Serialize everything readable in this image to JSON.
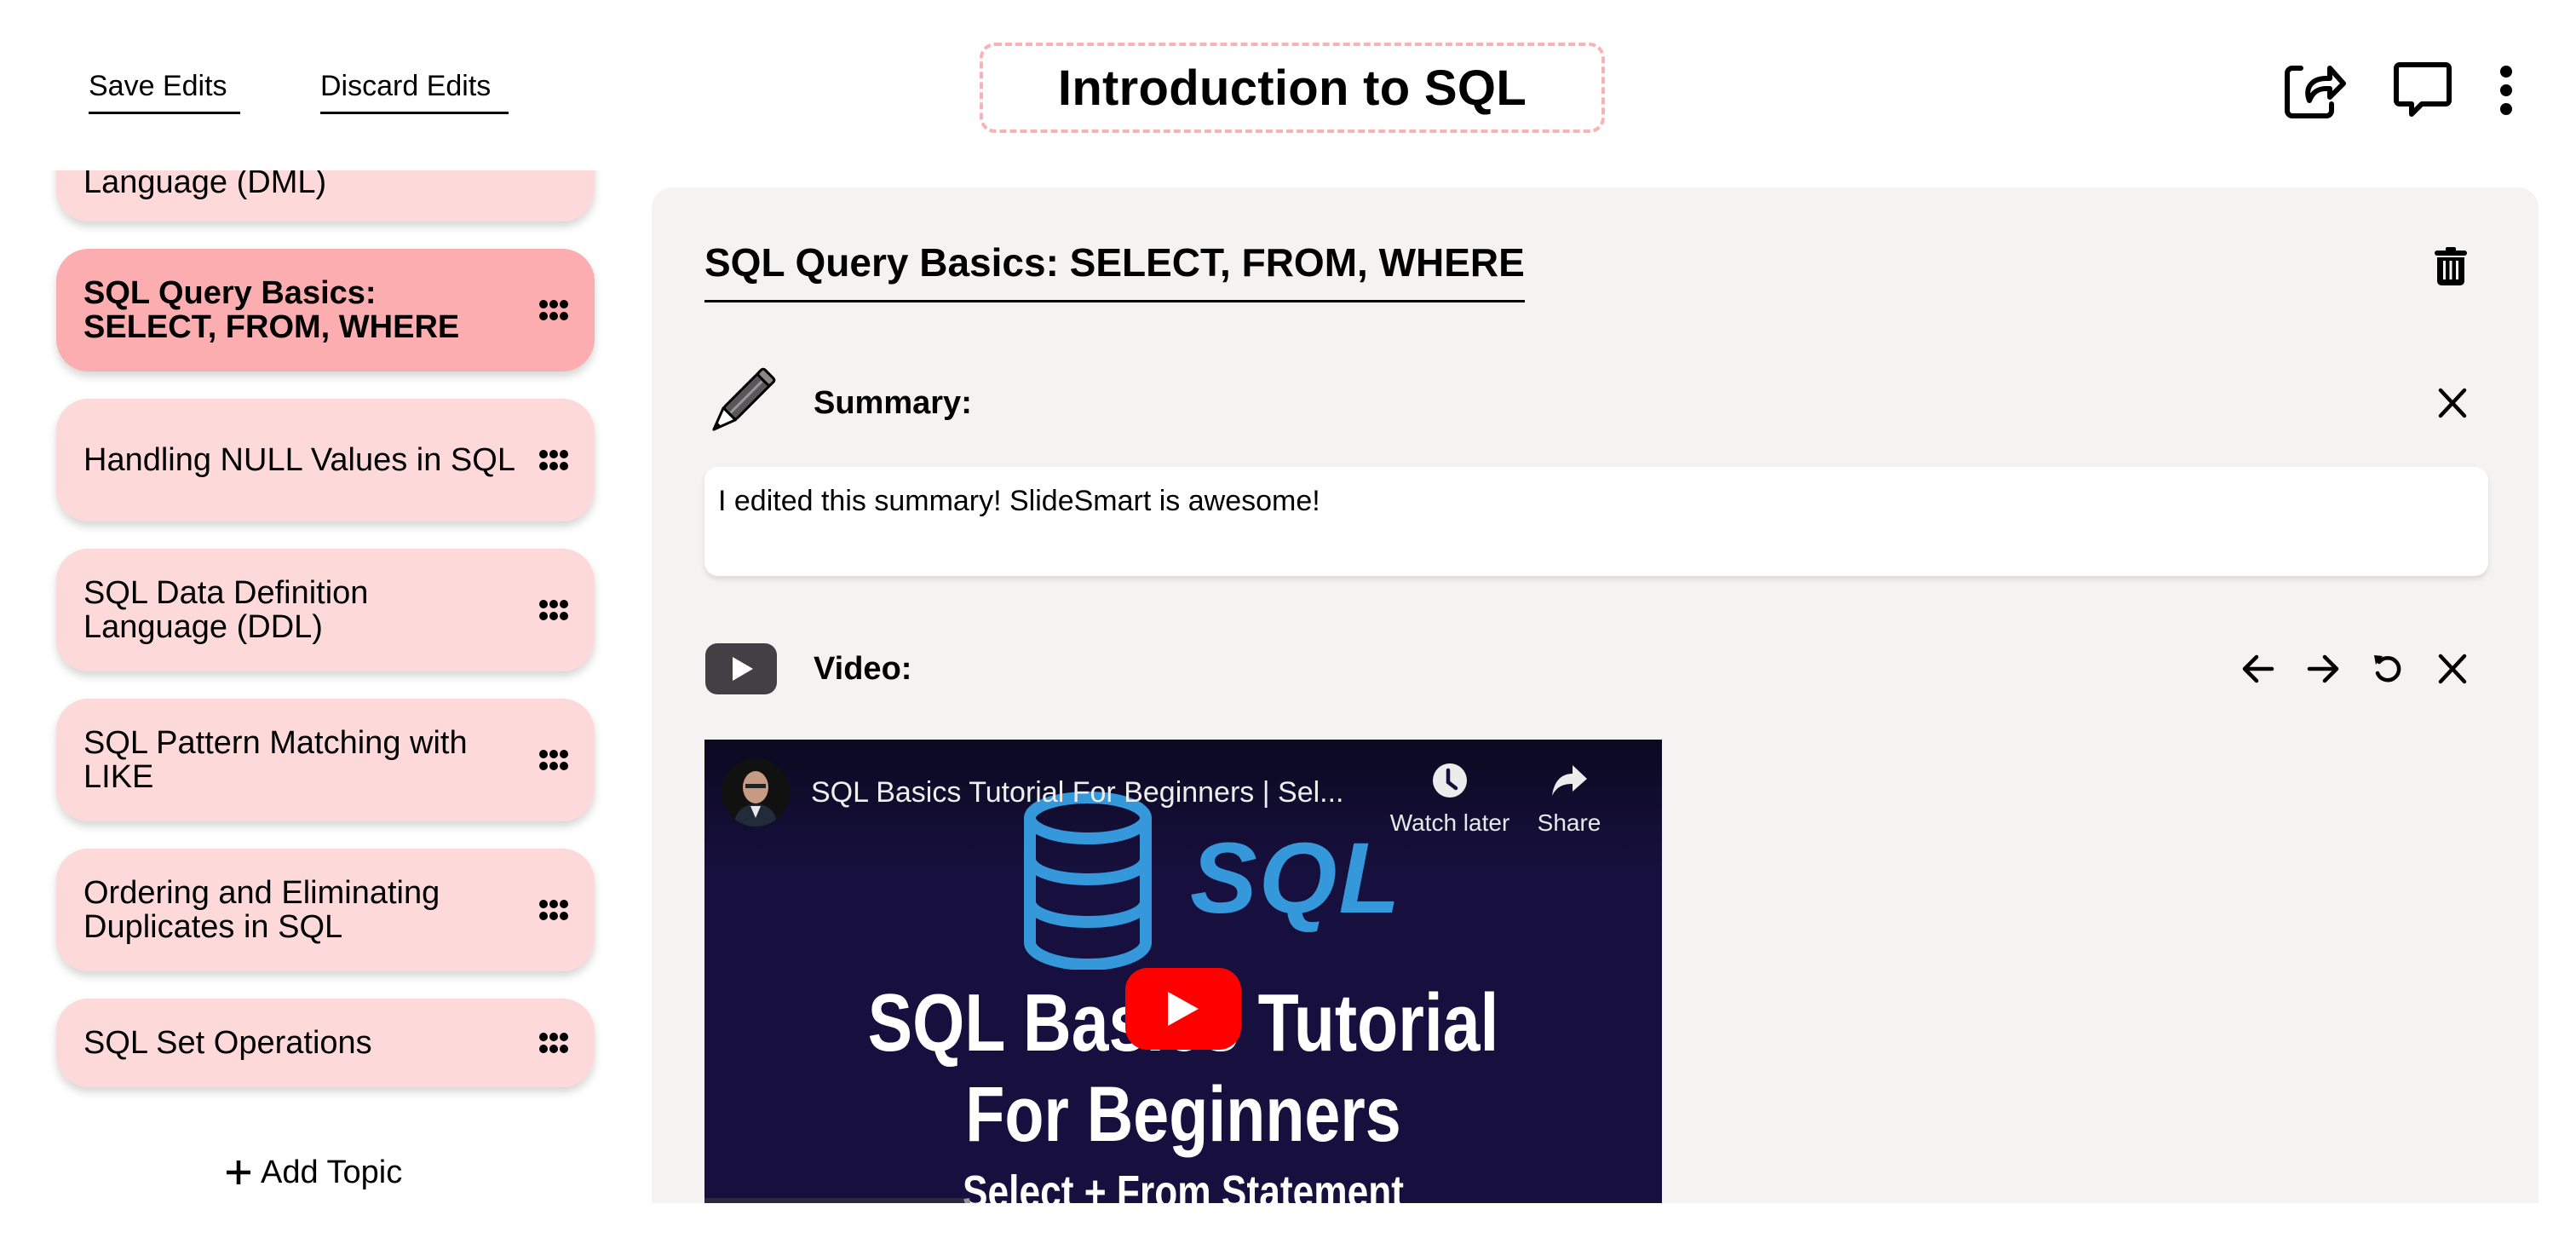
{
  "toolbar": {
    "save_label": "Save Edits",
    "discard_label": "Discard Edits",
    "presentation_title": "Introduction to SQL",
    "icons": [
      "share-icon",
      "comment-icon",
      "more-vertical-icon"
    ]
  },
  "sidebar": {
    "topics": [
      {
        "label": "SQL Data Manipulation Language (DML)",
        "visible_label": "Language (DML)",
        "active": false
      },
      {
        "label": "SQL Query Basics: SELECT, FROM, WHERE",
        "active": true
      },
      {
        "label": "Handling NULL Values in SQL",
        "active": false
      },
      {
        "label": "SQL Data Definition Language (DDL)",
        "active": false
      },
      {
        "label": "SQL Pattern Matching with LIKE",
        "active": false
      },
      {
        "label": "Ordering and Eliminating Duplicates in SQL",
        "active": false
      },
      {
        "label": "SQL Set Operations",
        "active": false
      }
    ],
    "add_topic_label": "Add Topic",
    "add_topic_icon": "plus-icon",
    "drag_icon": "drag-handle-icon"
  },
  "main": {
    "topic_title": "SQL Query Basics: SELECT, FROM, WHERE",
    "summary": {
      "label": "Summary:",
      "icon": "pencil-icon",
      "text": "I edited this summary! SlideSmart is awesome!"
    },
    "video": {
      "label": "Video:",
      "icon": "youtube-icon",
      "actions": [
        "arrow-left-icon",
        "arrow-right-icon",
        "refresh-icon",
        "close-icon"
      ],
      "player": {
        "title": "SQL Basics Tutorial For Beginners | Sel...",
        "watch_later_label": "Watch later",
        "share_label": "Share",
        "thumbnail_logo_text": "SQL",
        "thumbnail_line1": "SQL Basics Tutorial",
        "thumbnail_line2": "For Beginners",
        "thumbnail_line3": "Select + From Statement"
      }
    }
  },
  "colors": {
    "topic_bg": "#fdd9da",
    "topic_active_bg": "#fbadaf",
    "title_border": "#fbb2b4",
    "panel_bg": "#f4f3f2",
    "video_bg": "#17103f",
    "sql_blue": "#3498db",
    "yt_red": "#ff0000"
  }
}
